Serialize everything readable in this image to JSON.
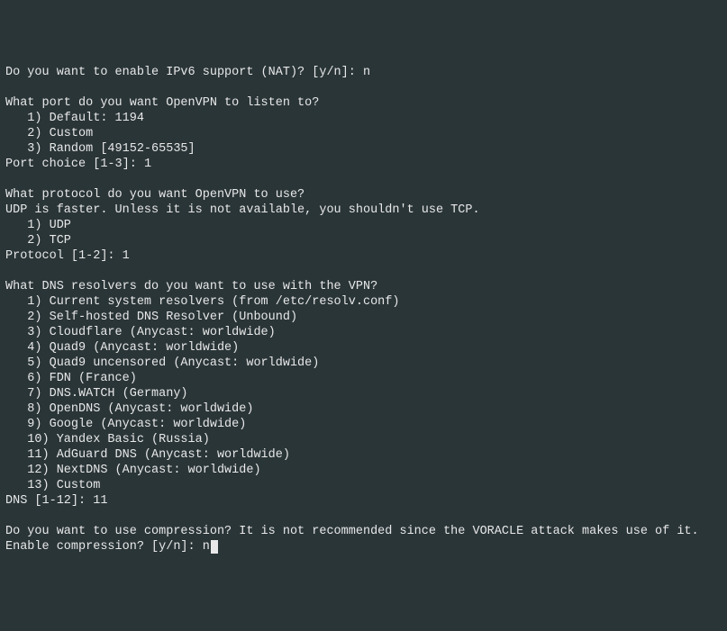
{
  "ipv6": {
    "prompt": "Do you want to enable IPv6 support (NAT)? [y/n]: ",
    "answer": "n"
  },
  "port": {
    "question": "What port do you want OpenVPN to listen to?",
    "opt1": "   1) Default: 1194",
    "opt2": "   2) Custom",
    "opt3": "   3) Random [49152-65535]",
    "choice_label": "Port choice [1-3]: ",
    "choice_value": "1"
  },
  "protocol": {
    "question": "What protocol do you want OpenVPN to use?",
    "hint": "UDP is faster. Unless it is not available, you shouldn't use TCP.",
    "opt1": "   1) UDP",
    "opt2": "   2) TCP",
    "choice_label": "Protocol [1-2]: ",
    "choice_value": "1"
  },
  "dns": {
    "question": "What DNS resolvers do you want to use with the VPN?",
    "opt1": "   1) Current system resolvers (from /etc/resolv.conf)",
    "opt2": "   2) Self-hosted DNS Resolver (Unbound)",
    "opt3": "   3) Cloudflare (Anycast: worldwide)",
    "opt4": "   4) Quad9 (Anycast: worldwide)",
    "opt5": "   5) Quad9 uncensored (Anycast: worldwide)",
    "opt6": "   6) FDN (France)",
    "opt7": "   7) DNS.WATCH (Germany)",
    "opt8": "   8) OpenDNS (Anycast: worldwide)",
    "opt9": "   9) Google (Anycast: worldwide)",
    "opt10": "   10) Yandex Basic (Russia)",
    "opt11": "   11) AdGuard DNS (Anycast: worldwide)",
    "opt12": "   12) NextDNS (Anycast: worldwide)",
    "opt13": "   13) Custom",
    "choice_label": "DNS [1-12]: ",
    "choice_value": "11"
  },
  "compression": {
    "question": "Do you want to use compression? It is not recommended since the VORACLE attack makes use of it.",
    "prompt": "Enable compression? [y/n]: ",
    "answer": "n"
  }
}
